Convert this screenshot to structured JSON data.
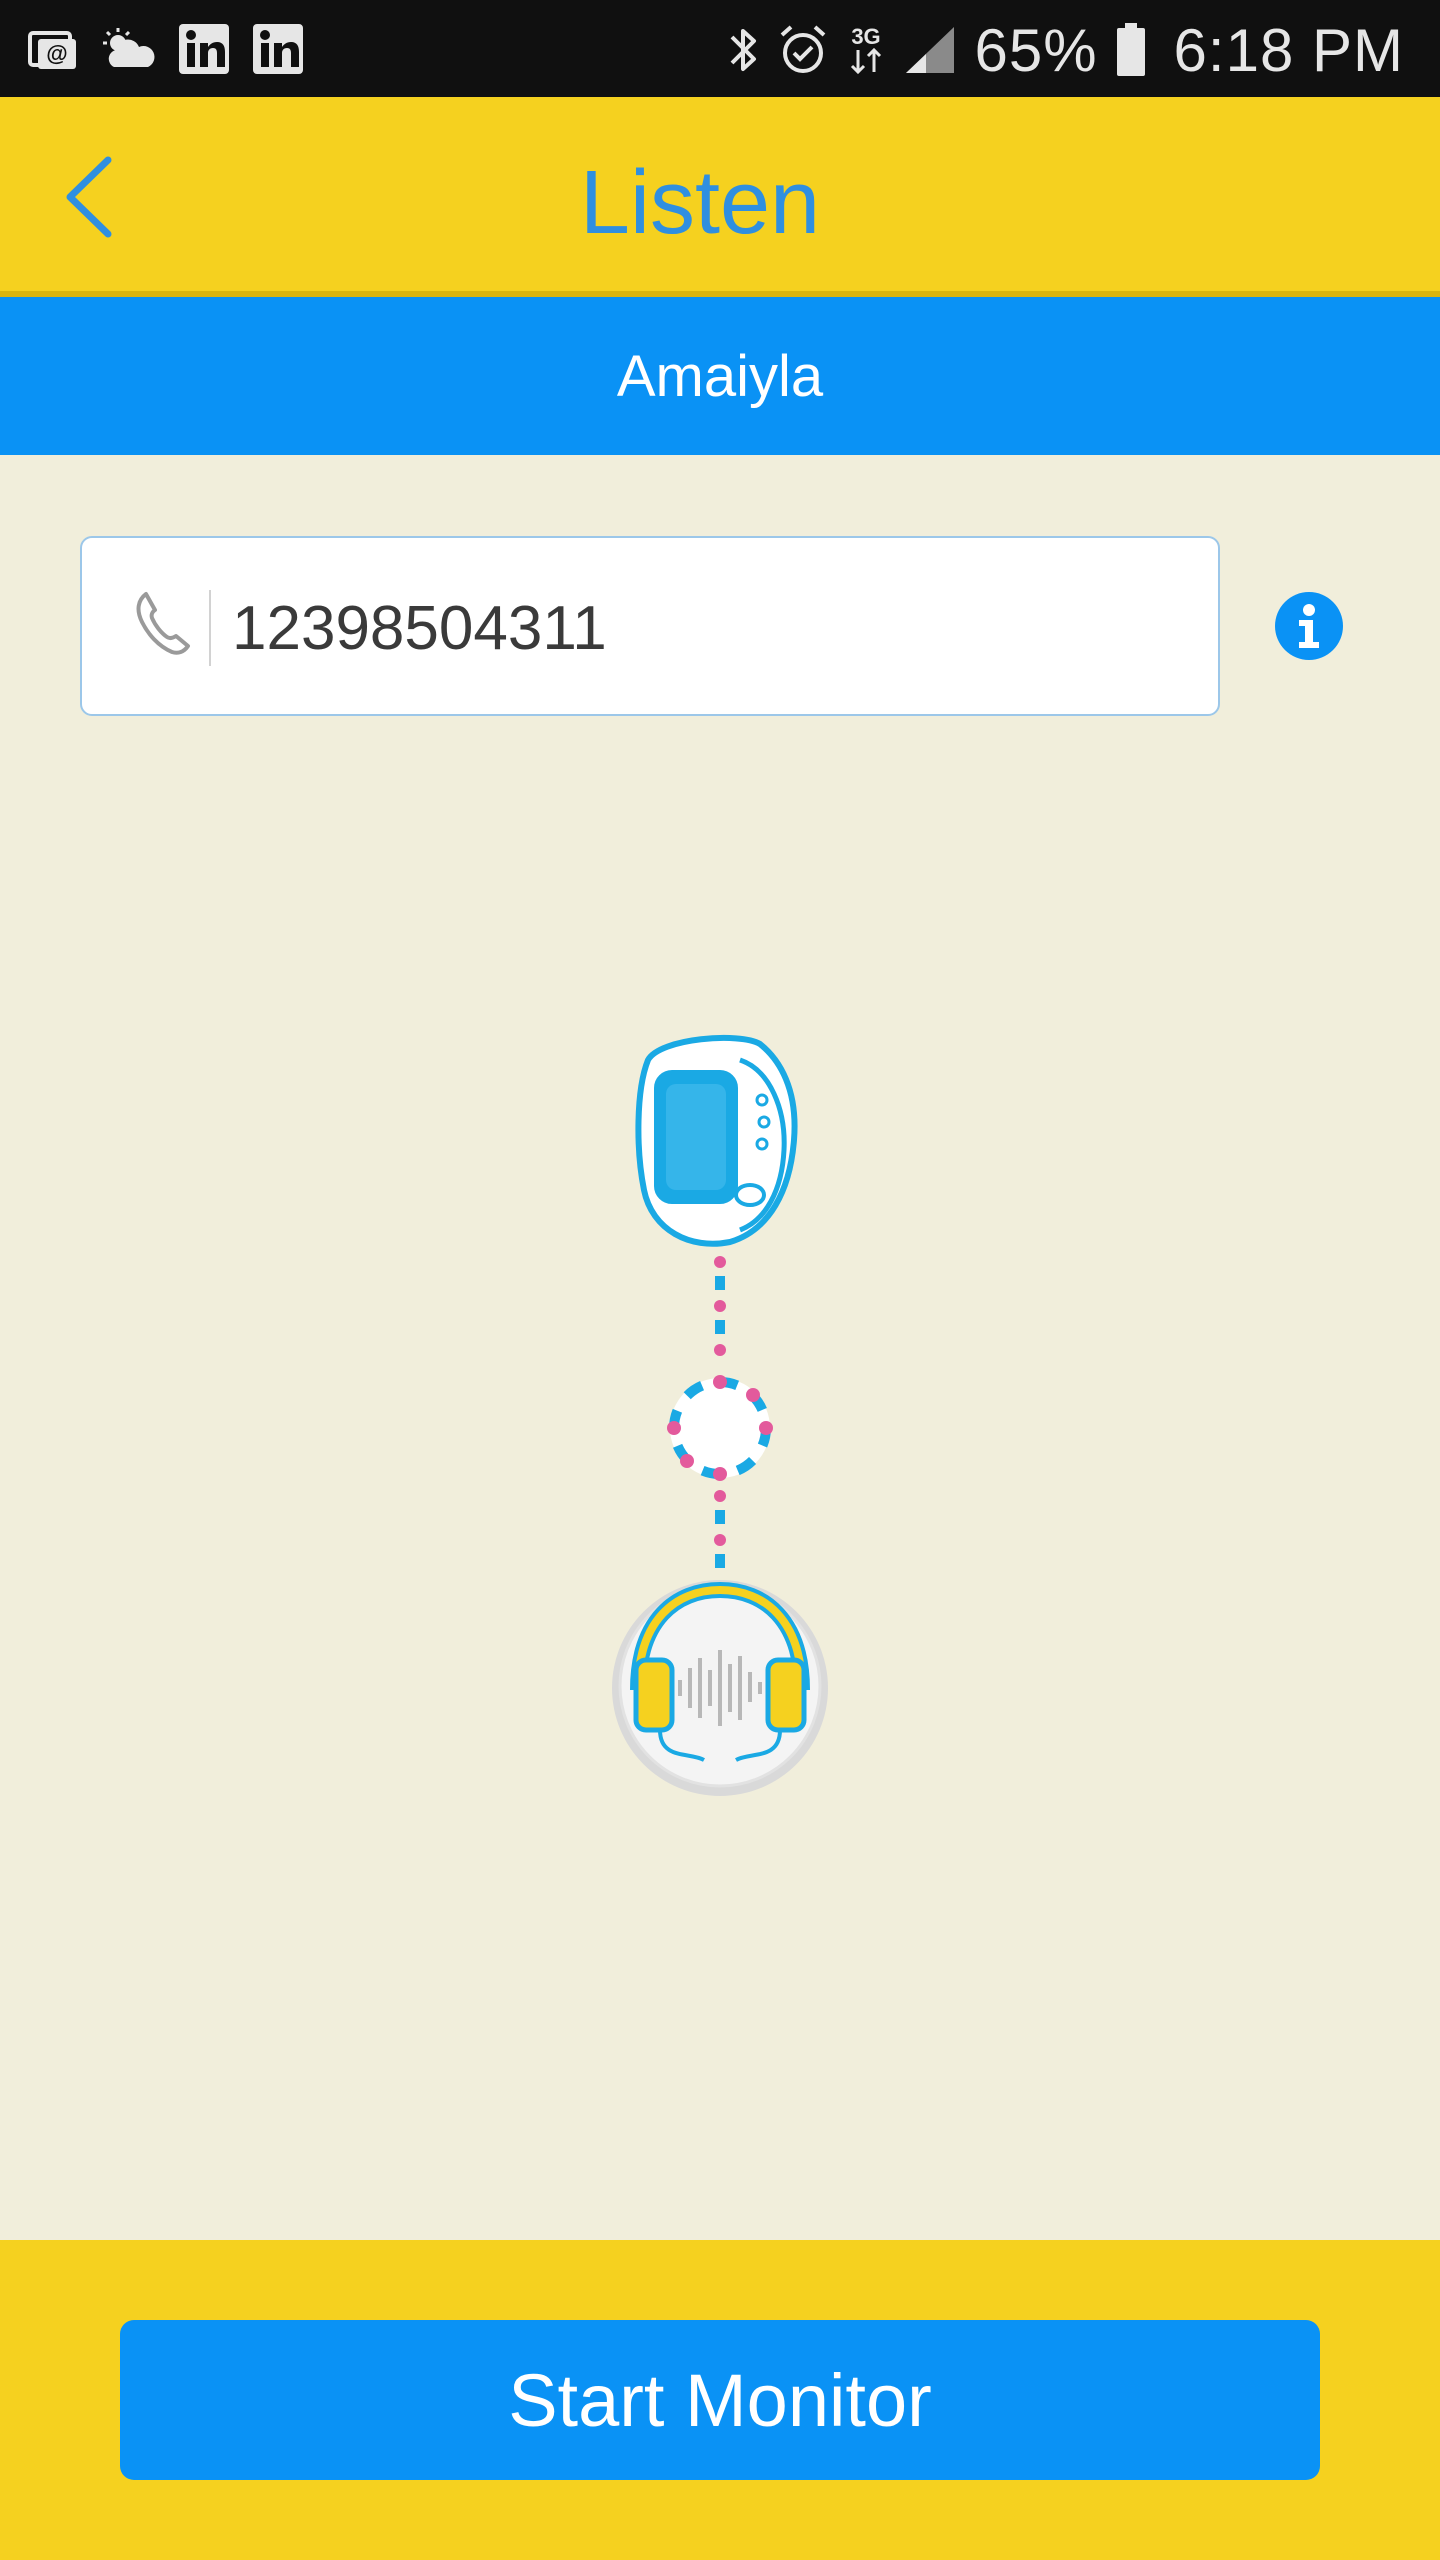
{
  "status_bar": {
    "battery_percent": "65%",
    "time": "6:18 PM",
    "network": "3G",
    "left_icons": [
      "email-notification-icon",
      "weather-icon",
      "linkedin-icon",
      "linkedin-icon"
    ],
    "right_icons": [
      "bluetooth-icon",
      "alarm-icon",
      "3g-data-icon",
      "signal-icon",
      "battery-icon"
    ]
  },
  "header": {
    "title": "Listen",
    "back_icon": "chevron-left-icon"
  },
  "device": {
    "name": "Amaiyla"
  },
  "phone": {
    "value": "12398504311",
    "icon": "phone-icon"
  },
  "info_icon": "info-icon",
  "illustration": {
    "top_icon": "smartwatch-icon",
    "middle_icon": "connection-ring-icon",
    "bottom_icon": "headphones-icon"
  },
  "footer": {
    "start_label": "Start Monitor"
  },
  "colors": {
    "yellow": "#f5d11f",
    "blue": "#0a92f5",
    "title_blue": "#2f8fe0",
    "background": "#f1eedb",
    "pink": "#e35a9c",
    "cyan": "#1aa9e4"
  }
}
